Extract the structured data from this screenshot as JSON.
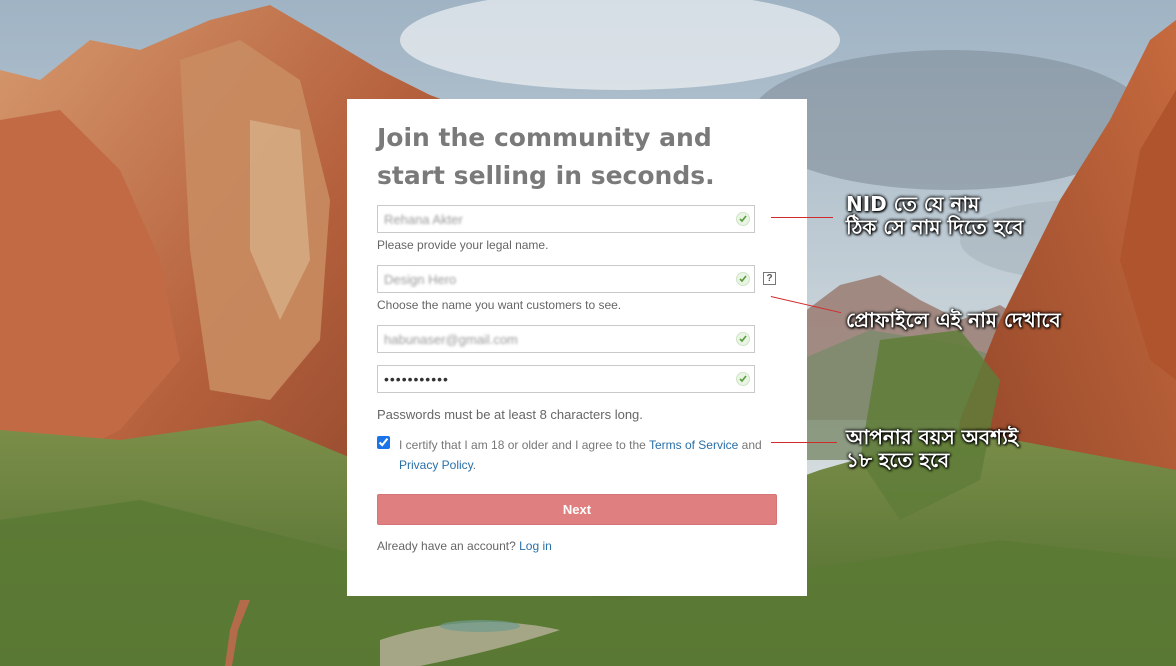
{
  "form": {
    "title": "Join the community and start selling in seconds.",
    "legal_name_value": "Rehana Akter",
    "legal_name_hint": "Please provide your legal name.",
    "display_name_value": "Design Hero",
    "display_name_hint": "Choose the name you want customers to see.",
    "email_value": "habunaser@gmail.com",
    "password_value": "•••••••••••",
    "password_note": "Passwords must be at least 8 characters long.",
    "certify_prefix": "I certify that I am 18 or older and I agree to the",
    "terms_link": "Terms of Service",
    "certify_and": "and",
    "privacy_link": "Privacy Policy",
    "certify_suffix": ".",
    "certify_checked": true,
    "next_label": "Next",
    "already_text": "Already have an account?",
    "login_link": "Log in",
    "help_glyph": "?"
  },
  "annotations": {
    "nid_line1": "NID তে যে নাম",
    "nid_line2": "ঠিক সে নাম দিতে হবে",
    "profile_line": "প্রোফাইলে এই নাম দেখাবে",
    "age_line1": "আপনার বয়স অবশ্যই",
    "age_line2": "১৮ হতে হবে"
  },
  "colors": {
    "accent_button": "#e07f7f",
    "link": "#2a6fa8",
    "pointer_line": "#d12a2a"
  }
}
